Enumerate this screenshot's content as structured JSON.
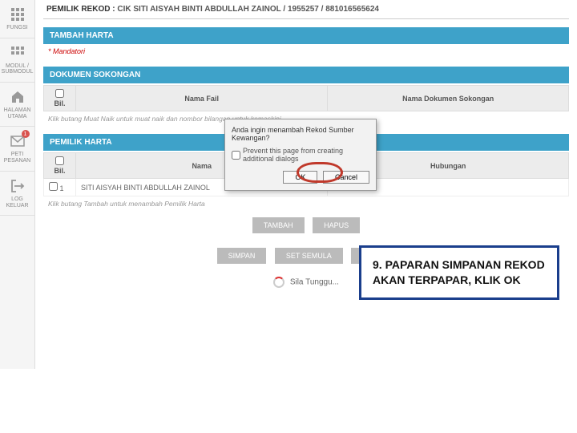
{
  "sidebar": {
    "items": [
      {
        "label": "FUNGSI",
        "icon": "grid-icon"
      },
      {
        "label": "MODUL / SUBMODUL",
        "icon": "grid-icon"
      },
      {
        "label": "HALAMAN UTAMA",
        "icon": "home-icon"
      },
      {
        "label": "PETI PESANAN",
        "icon": "mail-icon",
        "badge": "1"
      },
      {
        "label": "LOG KELUAR",
        "icon": "logout-icon"
      }
    ]
  },
  "header": {
    "owner_label": "PEMILIK REKOD :",
    "owner_value": "CIK SITI AISYAH BINTI ABDULLAH ZAINOL / 1955257 / 881016565624"
  },
  "sections": {
    "tambah_harta": "TAMBAH HARTA",
    "dokumen_sokongan": "DOKUMEN SOKONGAN",
    "pemilik_harta": "PEMILIK HARTA"
  },
  "mandatory": "* Mandatori",
  "dok_table": {
    "col_bil": "Bil.",
    "col_nama": "Nama Fail",
    "col_doc": "Nama Dokumen Sokongan"
  },
  "dok_hint": "Klik butang Muat Naik untuk muat naik dan nombor bilangan untuk kemaskini",
  "pemilik_table": {
    "col_bil": "Bil.",
    "col_nama": "Nama",
    "col_hub": "Hubungan",
    "rows": [
      {
        "bil": "1",
        "nama": "SITI AISYAH BINTI ABDULLAH ZAINOL",
        "hub": "SENDIRI"
      }
    ]
  },
  "pemilik_hint": "Klik butang Tambah untuk menambah Pemilik Harta",
  "buttons": {
    "tambah": "TAMBAH",
    "hapus": "HAPUS",
    "simpan": "SIMPAN",
    "set_semula": "SET SEMULA",
    "batal": "BATAL"
  },
  "spinner_text": "Sila Tunggu...",
  "dialog": {
    "message": "Anda ingin menambah Rekod Sumber Kewangan?",
    "prevent": "Prevent this page from creating additional dialogs",
    "ok": "OK",
    "cancel": "Cancel"
  },
  "callout": "9. PAPARAN SIMPANAN REKOD AKAN TERPAPAR, KLIK OK"
}
